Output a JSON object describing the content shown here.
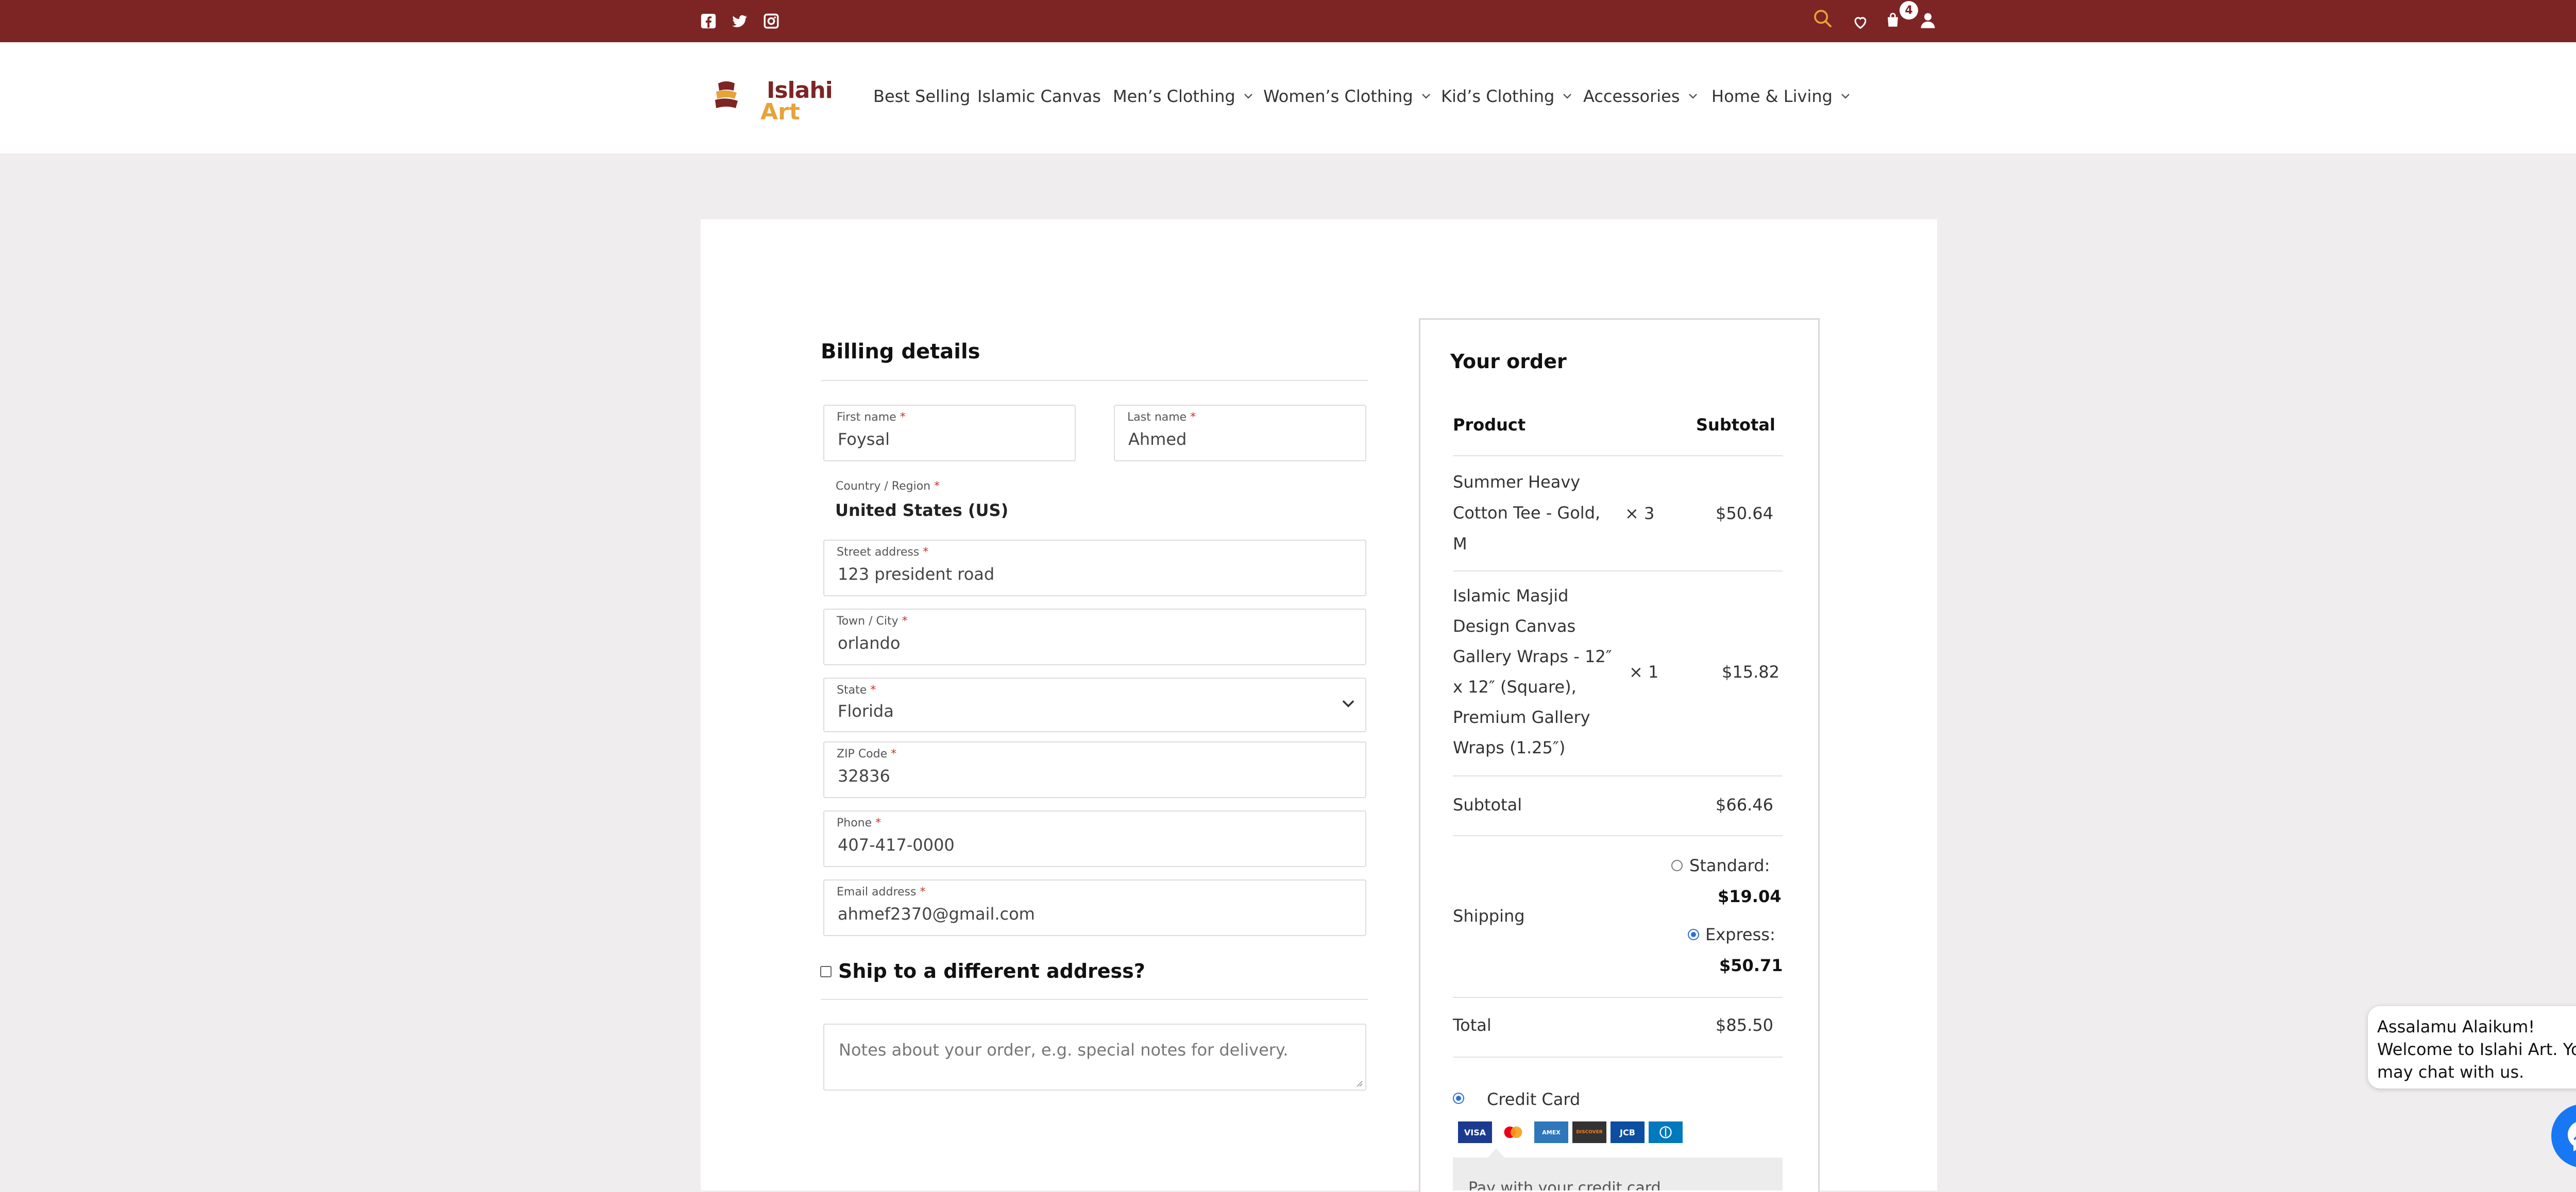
{
  "topbar": {
    "social_icons": [
      "facebook-icon",
      "twitter-icon",
      "instagram-icon"
    ],
    "cart_count": "4",
    "icons": [
      "search-icon",
      "heart-icon",
      "cart-icon",
      "user-icon"
    ]
  },
  "brand": {
    "logo_line1": "Islahi",
    "logo_line2": "Art"
  },
  "nav": {
    "items": [
      {
        "label": "Best Selling"
      },
      {
        "label": "Islamic Canvas"
      },
      {
        "label": "Men’s Clothing"
      },
      {
        "label": "Women’s Clothing"
      },
      {
        "label": "Kid’s Clothing"
      },
      {
        "label": "Accessories"
      },
      {
        "label": "Home & Living"
      }
    ]
  },
  "billing": {
    "title": "Billing details",
    "first_name": {
      "label": "First name",
      "value": "Foysal"
    },
    "last_name": {
      "label": "Last name",
      "value": "Ahmed"
    },
    "country": {
      "label": "Country / Region",
      "value": "United States (US)"
    },
    "street": {
      "label": "Street address",
      "value": "123 president road"
    },
    "city": {
      "label": "Town / City",
      "value": "orlando"
    },
    "state": {
      "label": "State",
      "value": "Florida"
    },
    "zip": {
      "label": "ZIP Code",
      "value": "32836"
    },
    "phone": {
      "label": "Phone",
      "value": "407-417-0000"
    },
    "email": {
      "label": "Email address",
      "value": "ahmef2370@gmail.com"
    },
    "required_mark": "*",
    "ship_different": "Ship to a different address?",
    "notes_placeholder": "Notes about your order, e.g. special notes for delivery."
  },
  "order": {
    "title": "Your order",
    "col_product": "Product",
    "col_subtotal": "Subtotal",
    "items": [
      {
        "name_lines": [
          "Summer Heavy",
          "Cotton Tee - Gold,",
          "M"
        ],
        "qty": "× 3",
        "price": "$50.64"
      },
      {
        "name_lines": [
          "Islamic Masjid",
          "Design Canvas",
          "Gallery Wraps - 12″",
          "x 12″ (Square),",
          "Premium Gallery",
          "Wraps (1.25″)"
        ],
        "qty": "× 1",
        "price": "$15.82"
      }
    ],
    "subtotal_label": "Subtotal",
    "subtotal_value": "$66.46",
    "shipping_label": "Shipping",
    "standard_label": "Standard:",
    "standard_price": "$19.04",
    "express_label": "Express:",
    "express_price": "$50.71",
    "selected_shipping": "Express",
    "total_label": "Total",
    "total_value": "$85.50",
    "payment_method": "Credit Card",
    "card_brands": [
      "VISA",
      "MC",
      "AMEX",
      "DISCOVER",
      "JCB",
      "DINERS"
    ],
    "pay_note": "Pay with your credit card"
  },
  "chat": {
    "message": "Assalamu Alaikum! Welcome to Islahi Art. You may chat with us."
  },
  "colors": {
    "brand_maroon": "#7d2424",
    "accent_orange": "#e6a33a",
    "messenger_blue": "#1877f2"
  }
}
